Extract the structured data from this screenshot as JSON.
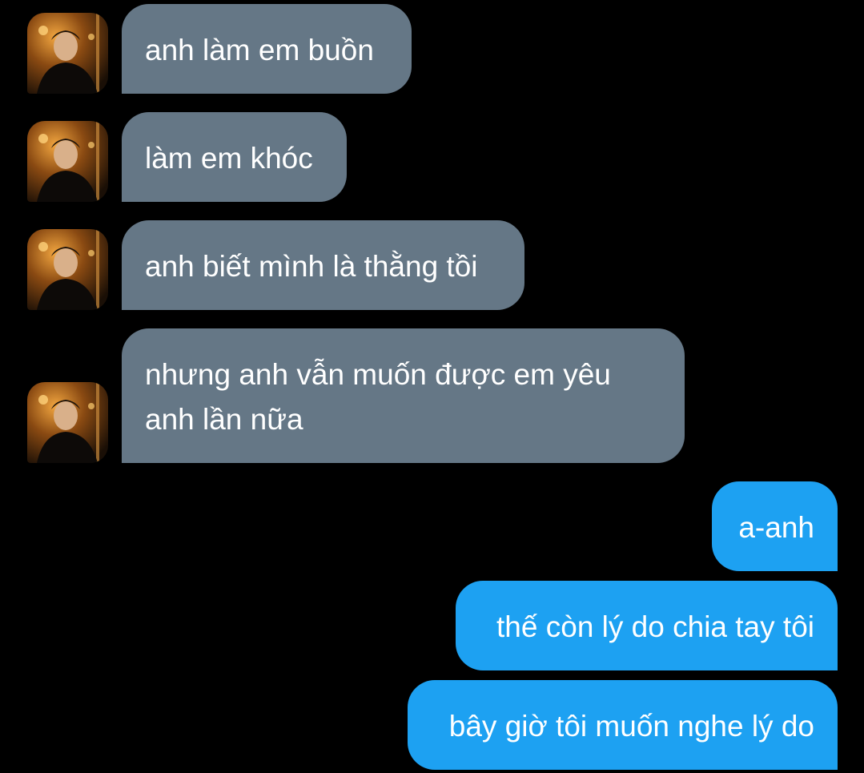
{
  "conversation": {
    "colors": {
      "background": "#000000",
      "incoming_bubble": "#657786",
      "outgoing_bubble": "#1da1f2",
      "text": "#ffffff"
    },
    "avatar": {
      "icon": "user-profile-photo"
    },
    "incoming": [
      {
        "text": "anh làm em buồn"
      },
      {
        "text": "làm em khóc"
      },
      {
        "text": "anh biết mình là thằng tồi"
      },
      {
        "lines": [
          "nhưng anh vẫn muốn được em yêu",
          "anh lần nữa"
        ]
      }
    ],
    "outgoing": [
      {
        "text": "a-anh"
      },
      {
        "text": "thế còn lý do chia tay tôi"
      },
      {
        "text": "bây giờ tôi muốn nghe lý do"
      }
    ]
  }
}
